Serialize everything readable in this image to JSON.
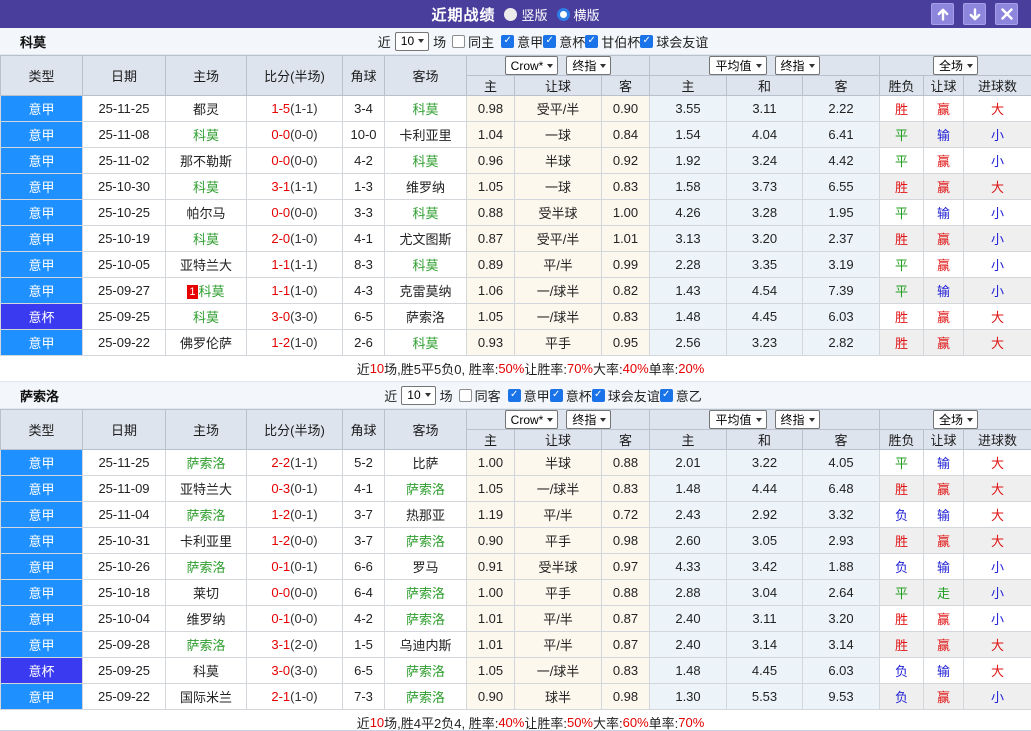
{
  "window": {
    "title": "近期战绩",
    "layout_options": [
      {
        "label": "竖版",
        "selected": true
      },
      {
        "label": "横版",
        "selected": false
      }
    ],
    "buttons": {
      "up": "move-up",
      "down": "move-down",
      "close": "close"
    }
  },
  "colors": {
    "titlebar": "#4a3e9c",
    "league_type": "#1e90ff",
    "cup_type": "#3a3af0",
    "win_red": "#e01515",
    "draw_green": "#1f9e1f",
    "lose_blue": "#2323d6",
    "team_green": "#2e9e2e",
    "score_red": "#e60000"
  },
  "table_headers": {
    "left": [
      "类型",
      "日期",
      "主场",
      "比分(半场)",
      "角球",
      "客场"
    ],
    "odds_sub": [
      "主",
      "让球",
      "客"
    ],
    "avg_sub": [
      "主",
      "和",
      "客"
    ],
    "result_sub": [
      "胜负",
      "让球",
      "进球数"
    ]
  },
  "sections": [
    {
      "team": "科莫",
      "filter": {
        "recent_label": "近",
        "recent_value": "10",
        "unit_label": "场",
        "venue": {
          "label": "同主",
          "checked": false
        },
        "leagues": [
          {
            "label": "意甲",
            "checked": true
          },
          {
            "label": "意杯",
            "checked": true
          },
          {
            "label": "甘伯杯",
            "checked": true
          },
          {
            "label": "球会友谊",
            "checked": true
          }
        ]
      },
      "dropdowns": {
        "odds_source": "Crow*",
        "odds_phase": "终指",
        "avg_source": "平均值",
        "avg_phase": "终指",
        "scope": "全场"
      },
      "rows": [
        {
          "type": "意甲",
          "date": "25-11-25",
          "home": "都灵",
          "score": "1-5",
          "half": "(1-1)",
          "corner": "3-4",
          "away": "科莫",
          "odds": [
            "0.98",
            "受平/半",
            "0.90"
          ],
          "avg": [
            "3.55",
            "3.11",
            "2.22"
          ],
          "res": [
            "胜",
            "赢",
            "大"
          ]
        },
        {
          "type": "意甲",
          "date": "25-11-08",
          "home": "科莫",
          "score": "0-0",
          "half": "(0-0)",
          "corner": "10-0",
          "away": "卡利亚里",
          "odds": [
            "1.04",
            "一球",
            "0.84"
          ],
          "avg": [
            "1.54",
            "4.04",
            "6.41"
          ],
          "res": [
            "平",
            "输",
            "小"
          ]
        },
        {
          "type": "意甲",
          "date": "25-11-02",
          "home": "那不勒斯",
          "score": "0-0",
          "half": "(0-0)",
          "corner": "4-2",
          "away": "科莫",
          "odds": [
            "0.96",
            "半球",
            "0.92"
          ],
          "avg": [
            "1.92",
            "3.24",
            "4.42"
          ],
          "res": [
            "平",
            "赢",
            "小"
          ]
        },
        {
          "type": "意甲",
          "date": "25-10-30",
          "home": "科莫",
          "score": "3-1",
          "half": "(1-1)",
          "corner": "1-3",
          "away": "维罗纳",
          "odds": [
            "1.05",
            "一球",
            "0.83"
          ],
          "avg": [
            "1.58",
            "3.73",
            "6.55"
          ],
          "res": [
            "胜",
            "赢",
            "大"
          ]
        },
        {
          "type": "意甲",
          "date": "25-10-25",
          "home": "帕尔马",
          "score": "0-0",
          "half": "(0-0)",
          "corner": "3-3",
          "away": "科莫",
          "odds": [
            "0.88",
            "受半球",
            "1.00"
          ],
          "avg": [
            "4.26",
            "3.28",
            "1.95"
          ],
          "res": [
            "平",
            "输",
            "小"
          ]
        },
        {
          "type": "意甲",
          "date": "25-10-19",
          "home": "科莫",
          "score": "2-0",
          "half": "(1-0)",
          "corner": "4-1",
          "away": "尤文图斯",
          "odds": [
            "0.87",
            "受平/半",
            "1.01"
          ],
          "avg": [
            "3.13",
            "3.20",
            "2.37"
          ],
          "res": [
            "胜",
            "赢",
            "小"
          ]
        },
        {
          "type": "意甲",
          "date": "25-10-05",
          "home": "亚特兰大",
          "score": "1-1",
          "half": "(1-1)",
          "corner": "8-3",
          "away": "科莫",
          "odds": [
            "0.89",
            "平/半",
            "0.99"
          ],
          "avg": [
            "2.28",
            "3.35",
            "3.19"
          ],
          "res": [
            "平",
            "赢",
            "小"
          ]
        },
        {
          "type": "意甲",
          "date": "25-09-27",
          "home": "科莫",
          "home_badge": "1",
          "score": "1-1",
          "half": "(1-0)",
          "corner": "4-3",
          "away": "克雷莫纳",
          "odds": [
            "1.06",
            "一/球半",
            "0.82"
          ],
          "avg": [
            "1.43",
            "4.54",
            "7.39"
          ],
          "res": [
            "平",
            "输",
            "小"
          ]
        },
        {
          "type": "意杯",
          "date": "25-09-25",
          "home": "科莫",
          "score": "3-0",
          "half": "(3-0)",
          "corner": "6-5",
          "away": "萨索洛",
          "odds": [
            "1.05",
            "一/球半",
            "0.83"
          ],
          "avg": [
            "1.48",
            "4.45",
            "6.03"
          ],
          "res": [
            "胜",
            "赢",
            "大"
          ]
        },
        {
          "type": "意甲",
          "date": "25-09-22",
          "home": "佛罗伦萨",
          "score": "1-2",
          "half": "(1-0)",
          "corner": "2-6",
          "away": "科莫",
          "odds": [
            "0.93",
            "平手",
            "0.95"
          ],
          "avg": [
            "2.56",
            "3.23",
            "2.82"
          ],
          "res": [
            "胜",
            "赢",
            "大"
          ]
        }
      ],
      "summary": [
        {
          "text": "近",
          "red": false
        },
        {
          "text": "10",
          "red": true
        },
        {
          "text": "场,胜5平5负0, 胜率:",
          "red": false
        },
        {
          "text": "50%",
          "red": true
        },
        {
          "text": " 让胜率:",
          "red": false
        },
        {
          "text": "70%",
          "red": true
        },
        {
          "text": " 大率:",
          "red": false
        },
        {
          "text": "40%",
          "red": true
        },
        {
          "text": " 单率:",
          "red": false
        },
        {
          "text": "20%",
          "red": true
        }
      ]
    },
    {
      "team": "萨索洛",
      "filter": {
        "recent_label": "近",
        "recent_value": "10",
        "unit_label": "场",
        "venue": {
          "label": "同客",
          "checked": false
        },
        "leagues": [
          {
            "label": "意甲",
            "checked": true
          },
          {
            "label": "意杯",
            "checked": true
          },
          {
            "label": "球会友谊",
            "checked": true
          },
          {
            "label": "意乙",
            "checked": true
          }
        ]
      },
      "dropdowns": {
        "odds_source": "Crow*",
        "odds_phase": "终指",
        "avg_source": "平均值",
        "avg_phase": "终指",
        "scope": "全场"
      },
      "rows": [
        {
          "type": "意甲",
          "date": "25-11-25",
          "home": "萨索洛",
          "score": "2-2",
          "half": "(1-1)",
          "corner": "5-2",
          "away": "比萨",
          "odds": [
            "1.00",
            "半球",
            "0.88"
          ],
          "avg": [
            "2.01",
            "3.22",
            "4.05"
          ],
          "res": [
            "平",
            "输",
            "大"
          ]
        },
        {
          "type": "意甲",
          "date": "25-11-09",
          "home": "亚特兰大",
          "score": "0-3",
          "half": "(0-1)",
          "corner": "4-1",
          "away": "萨索洛",
          "odds": [
            "1.05",
            "一/球半",
            "0.83"
          ],
          "avg": [
            "1.48",
            "4.44",
            "6.48"
          ],
          "res": [
            "胜",
            "赢",
            "大"
          ]
        },
        {
          "type": "意甲",
          "date": "25-11-04",
          "home": "萨索洛",
          "score": "1-2",
          "half": "(0-1)",
          "corner": "3-7",
          "away": "热那亚",
          "odds": [
            "1.19",
            "平/半",
            "0.72"
          ],
          "avg": [
            "2.43",
            "2.92",
            "3.32"
          ],
          "res": [
            "负",
            "输",
            "大"
          ]
        },
        {
          "type": "意甲",
          "date": "25-10-31",
          "home": "卡利亚里",
          "score": "1-2",
          "half": "(0-0)",
          "corner": "3-7",
          "away": "萨索洛",
          "odds": [
            "0.90",
            "平手",
            "0.98"
          ],
          "avg": [
            "2.60",
            "3.05",
            "2.93"
          ],
          "res": [
            "胜",
            "赢",
            "大"
          ]
        },
        {
          "type": "意甲",
          "date": "25-10-26",
          "home": "萨索洛",
          "score": "0-1",
          "half": "(0-1)",
          "corner": "6-6",
          "away": "罗马",
          "odds": [
            "0.91",
            "受半球",
            "0.97"
          ],
          "avg": [
            "4.33",
            "3.42",
            "1.88"
          ],
          "res": [
            "负",
            "输",
            "小"
          ]
        },
        {
          "type": "意甲",
          "date": "25-10-18",
          "home": "莱切",
          "score": "0-0",
          "half": "(0-0)",
          "corner": "6-4",
          "away": "萨索洛",
          "odds": [
            "1.00",
            "平手",
            "0.88"
          ],
          "avg": [
            "2.88",
            "3.04",
            "2.64"
          ],
          "res": [
            "平",
            "走",
            "小"
          ]
        },
        {
          "type": "意甲",
          "date": "25-10-04",
          "home": "维罗纳",
          "score": "0-1",
          "half": "(0-0)",
          "corner": "4-2",
          "away": "萨索洛",
          "odds": [
            "1.01",
            "平/半",
            "0.87"
          ],
          "avg": [
            "2.40",
            "3.11",
            "3.20"
          ],
          "res": [
            "胜",
            "赢",
            "小"
          ]
        },
        {
          "type": "意甲",
          "date": "25-09-28",
          "home": "萨索洛",
          "score": "3-1",
          "half": "(2-0)",
          "corner": "1-5",
          "away": "乌迪内斯",
          "odds": [
            "1.01",
            "平/半",
            "0.87"
          ],
          "avg": [
            "2.40",
            "3.14",
            "3.14"
          ],
          "res": [
            "胜",
            "赢",
            "大"
          ]
        },
        {
          "type": "意杯",
          "date": "25-09-25",
          "home": "科莫",
          "score": "3-0",
          "half": "(3-0)",
          "corner": "6-5",
          "away": "萨索洛",
          "odds": [
            "1.05",
            "一/球半",
            "0.83"
          ],
          "avg": [
            "1.48",
            "4.45",
            "6.03"
          ],
          "res": [
            "负",
            "输",
            "大"
          ]
        },
        {
          "type": "意甲",
          "date": "25-09-22",
          "home": "国际米兰",
          "score": "2-1",
          "half": "(1-0)",
          "corner": "7-3",
          "away": "萨索洛",
          "odds": [
            "0.90",
            "球半",
            "0.98"
          ],
          "avg": [
            "1.30",
            "5.53",
            "9.53"
          ],
          "res": [
            "负",
            "赢",
            "小"
          ]
        }
      ],
      "summary": [
        {
          "text": "近",
          "red": false
        },
        {
          "text": "10",
          "red": true
        },
        {
          "text": "场,胜4平2负4, 胜率:",
          "red": false
        },
        {
          "text": "40%",
          "red": true
        },
        {
          "text": " 让胜率:",
          "red": false
        },
        {
          "text": "50%",
          "red": true
        },
        {
          "text": " 大率:",
          "red": false
        },
        {
          "text": "60%",
          "red": true
        },
        {
          "text": " 单率:",
          "red": false
        },
        {
          "text": "70%",
          "red": true
        }
      ]
    }
  ]
}
